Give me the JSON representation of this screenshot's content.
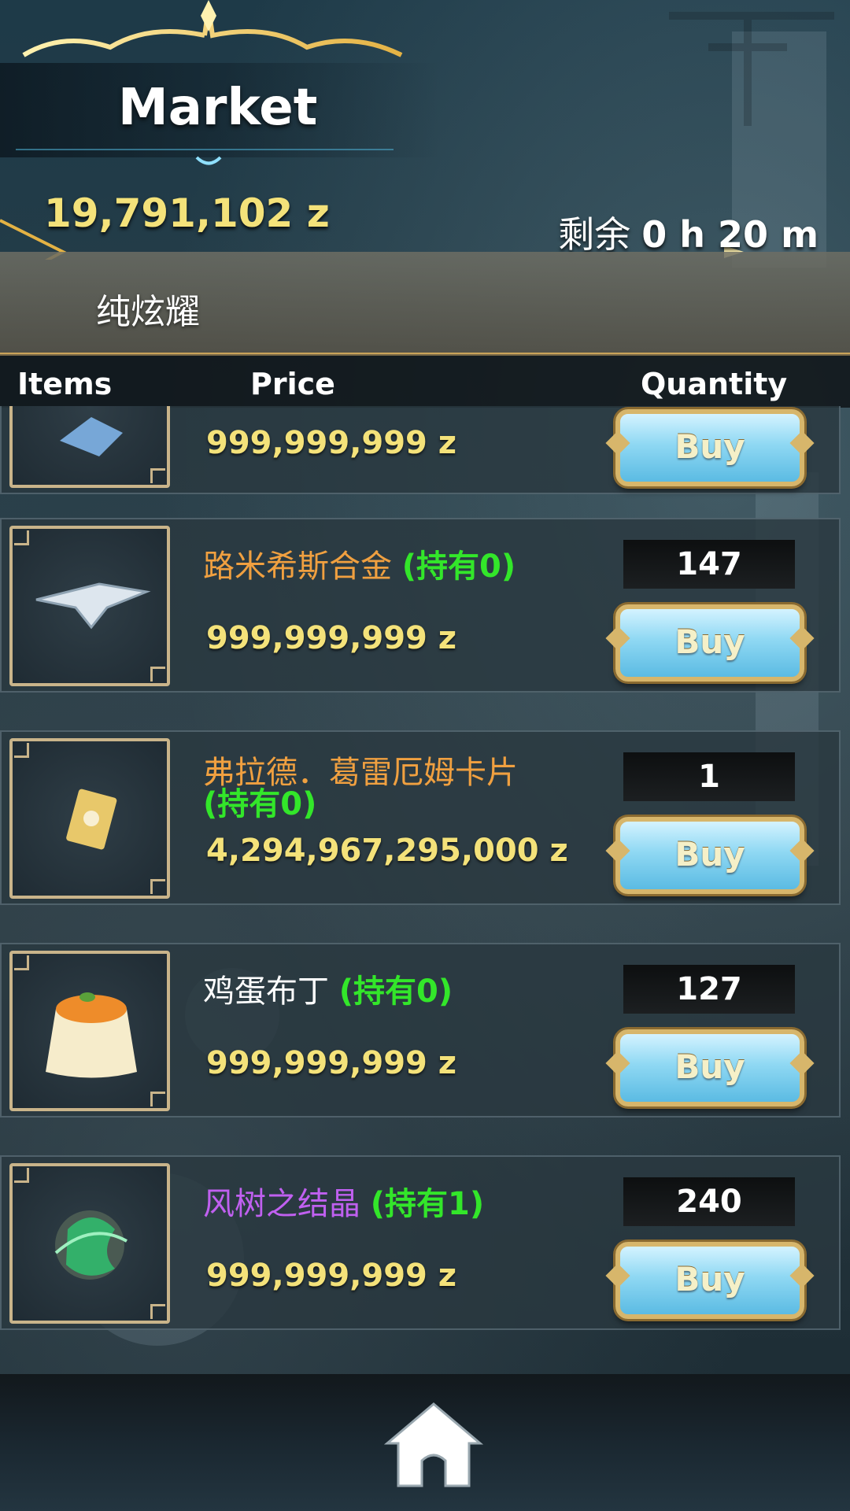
{
  "header": {
    "title": "Market",
    "currency": "19,791,102 z",
    "timer_prefix": "剩余",
    "timer_value": "0 h 20 m",
    "category": "纯炫耀"
  },
  "columns": {
    "items": "Items",
    "price": "Price",
    "quantity": "Quantity"
  },
  "rows": [
    {
      "name": "",
      "owned": "",
      "price": "999,999,999 z",
      "quantity": "",
      "buy_label": "Buy",
      "icon": "crystal-shard-icon"
    },
    {
      "name": "路米希斯合金 ",
      "owned": "(持有0)",
      "name_color": "#f0a040",
      "price": "999,999,999 z",
      "quantity": "147",
      "buy_label": "Buy",
      "icon": "alloy-wing-icon"
    },
    {
      "name": "弗拉德．葛雷厄姆卡片 ",
      "owned": "(持有0)",
      "name_color": "#f0a040",
      "price": "4,294,967,295,000 z",
      "quantity": "1",
      "buy_label": "Buy",
      "icon": "card-icon"
    },
    {
      "name": "鸡蛋布丁 ",
      "owned": "(持有0)",
      "name_color": "#ffffff",
      "price": "999,999,999 z",
      "quantity": "127",
      "buy_label": "Buy",
      "icon": "pudding-icon"
    },
    {
      "name": "风树之结晶 ",
      "owned": "(持有1)",
      "name_color": "#c060f0",
      "price": "999,999,999 z",
      "quantity": "240",
      "buy_label": "Buy",
      "icon": "wind-crystal-icon"
    }
  ],
  "footer": {
    "home_icon": "home-icon"
  }
}
